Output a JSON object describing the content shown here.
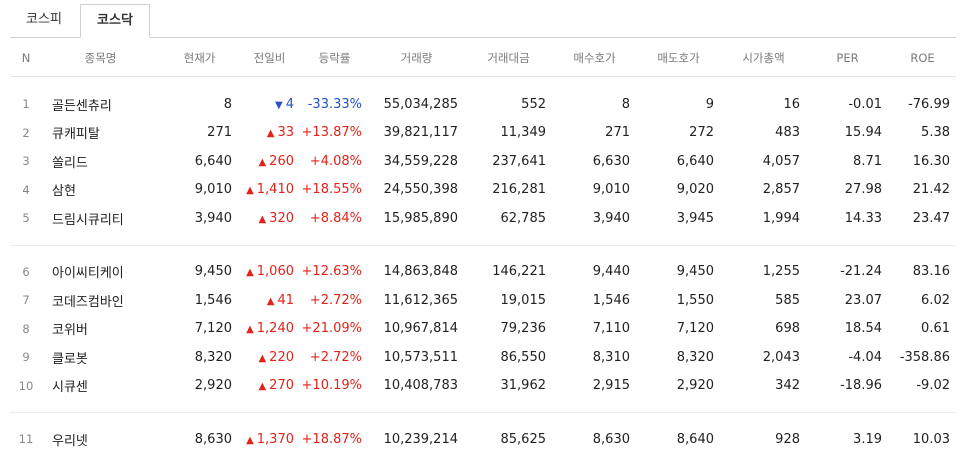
{
  "tabs": [
    {
      "label": "코스피",
      "active": false
    },
    {
      "label": "코스닥",
      "active": true
    }
  ],
  "columns": [
    "N",
    "종목명",
    "현재가",
    "전일비",
    "등락률",
    "거래량",
    "거래대금",
    "매수호가",
    "매도호가",
    "시가총액",
    "PER",
    "ROE"
  ],
  "groups": [
    [
      {
        "n": "1",
        "name": "골든센츄리",
        "price": "8",
        "dir": "down",
        "change": "4",
        "rate": "-33.33%",
        "volume": "55,034,285",
        "amount": "552",
        "bid": "8",
        "ask": "9",
        "mktcap": "16",
        "per": "-0.01",
        "roe": "-76.99"
      },
      {
        "n": "2",
        "name": "큐캐피탈",
        "price": "271",
        "dir": "up",
        "change": "33",
        "rate": "+13.87%",
        "volume": "39,821,117",
        "amount": "11,349",
        "bid": "271",
        "ask": "272",
        "mktcap": "483",
        "per": "15.94",
        "roe": "5.38"
      },
      {
        "n": "3",
        "name": "쏠리드",
        "price": "6,640",
        "dir": "up",
        "change": "260",
        "rate": "+4.08%",
        "volume": "34,559,228",
        "amount": "237,641",
        "bid": "6,630",
        "ask": "6,640",
        "mktcap": "4,057",
        "per": "8.71",
        "roe": "16.30"
      },
      {
        "n": "4",
        "name": "삼현",
        "price": "9,010",
        "dir": "up",
        "change": "1,410",
        "rate": "+18.55%",
        "volume": "24,550,398",
        "amount": "216,281",
        "bid": "9,010",
        "ask": "9,020",
        "mktcap": "2,857",
        "per": "27.98",
        "roe": "21.42"
      },
      {
        "n": "5",
        "name": "드림시큐리티",
        "price": "3,940",
        "dir": "up",
        "change": "320",
        "rate": "+8.84%",
        "volume": "15,985,890",
        "amount": "62,785",
        "bid": "3,940",
        "ask": "3,945",
        "mktcap": "1,994",
        "per": "14.33",
        "roe": "23.47"
      }
    ],
    [
      {
        "n": "6",
        "name": "아이씨티케이",
        "price": "9,450",
        "dir": "up",
        "change": "1,060",
        "rate": "+12.63%",
        "volume": "14,863,848",
        "amount": "146,221",
        "bid": "9,440",
        "ask": "9,450",
        "mktcap": "1,255",
        "per": "-21.24",
        "roe": "83.16"
      },
      {
        "n": "7",
        "name": "코데즈컴바인",
        "price": "1,546",
        "dir": "up",
        "change": "41",
        "rate": "+2.72%",
        "volume": "11,612,365",
        "amount": "19,015",
        "bid": "1,546",
        "ask": "1,550",
        "mktcap": "585",
        "per": "23.07",
        "roe": "6.02"
      },
      {
        "n": "8",
        "name": "코위버",
        "price": "7,120",
        "dir": "up",
        "change": "1,240",
        "rate": "+21.09%",
        "volume": "10,967,814",
        "amount": "79,236",
        "bid": "7,110",
        "ask": "7,120",
        "mktcap": "698",
        "per": "18.54",
        "roe": "0.61"
      },
      {
        "n": "9",
        "name": "클로봇",
        "price": "8,320",
        "dir": "up",
        "change": "220",
        "rate": "+2.72%",
        "volume": "10,573,511",
        "amount": "86,550",
        "bid": "8,310",
        "ask": "8,320",
        "mktcap": "2,043",
        "per": "-4.04",
        "roe": "-358.86"
      },
      {
        "n": "10",
        "name": "시큐센",
        "price": "2,920",
        "dir": "up",
        "change": "270",
        "rate": "+10.19%",
        "volume": "10,408,783",
        "amount": "31,962",
        "bid": "2,915",
        "ask": "2,920",
        "mktcap": "342",
        "per": "-18.96",
        "roe": "-9.02"
      }
    ],
    [
      {
        "n": "11",
        "name": "우리넷",
        "price": "8,630",
        "dir": "up",
        "change": "1,370",
        "rate": "+18.87%",
        "volume": "10,239,214",
        "amount": "85,625",
        "bid": "8,630",
        "ask": "8,640",
        "mktcap": "928",
        "per": "3.19",
        "roe": "10.03"
      }
    ]
  ],
  "arrows": {
    "up": "▲",
    "down": "▼"
  },
  "colors": {
    "up": "#e2231a",
    "down": "#2452c8",
    "header": "#7a7a7a"
  }
}
